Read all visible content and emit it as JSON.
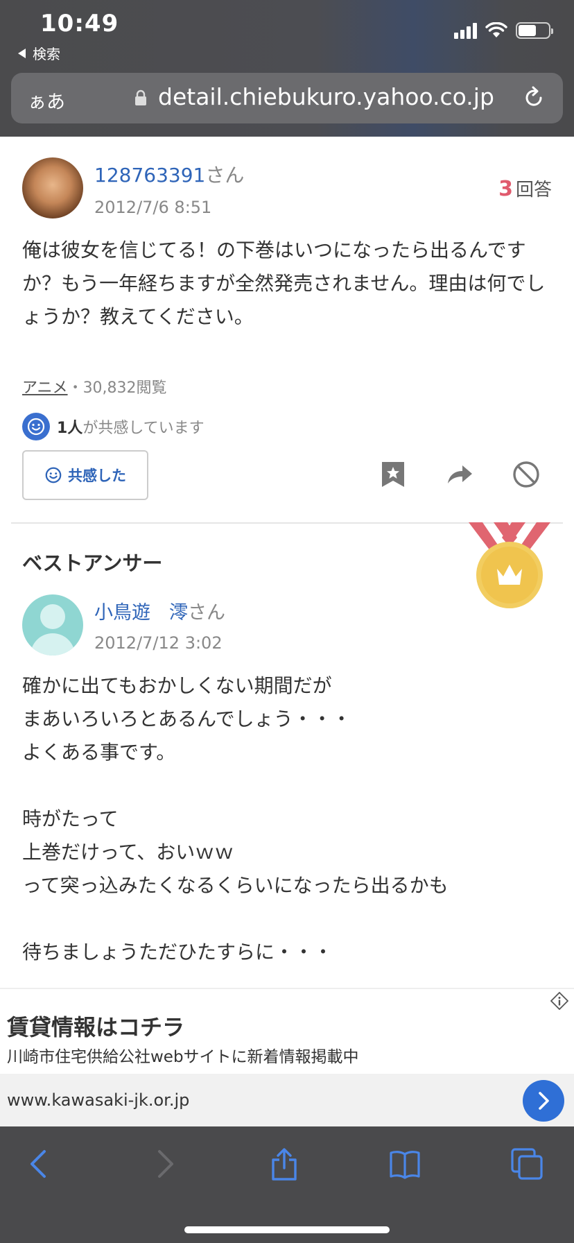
{
  "status_bar": {
    "time": "10:49",
    "back_label": "検索"
  },
  "browser": {
    "aa_label": "ぁあ",
    "url": "detail.chiebukuro.yahoo.co.jp"
  },
  "question": {
    "user_name": "128763391",
    "user_suffix": "さん",
    "date": "2012/7/6 8:51",
    "answer_count": "3",
    "answer_count_label": "回答",
    "text": "俺は彼女を信じてる！の下巻はいつになったら出るんですか？もう一年経ちますが全然発売されません。理由は何でしょうか？教えてください。",
    "category": "アニメ",
    "views": "・30,832閲覧",
    "empathy_count": "1人",
    "empathy_text": "が共感しています",
    "empathy_button": "共感した"
  },
  "best_answer": {
    "section_title": "ベストアンサー",
    "user_name": "小鳥遊　澪",
    "user_suffix": "さん",
    "date": "2012/7/12 3:02",
    "text": "確かに出てもおかしくない期間だが\nまあいろいろとあるんでしょう・・・\nよくある事です。\n\n時がたって\n上巻だけって、おいｗｗ\nって突っ込みたくなるくらいになったら出るかも\n\n待ちましょうただひたすらに・・・"
  },
  "ad": {
    "title": "賃貸情報はコチラ",
    "subtitle": "川崎市住宅供給公社webサイトに新着情報掲載中",
    "url": "www.kawasaki-jk.or.jp"
  },
  "colors": {
    "link": "#2e64b8",
    "accent_red": "#e05a6d",
    "toolbar": "#4a4a4c",
    "icon_blue": "#4a86e8"
  }
}
